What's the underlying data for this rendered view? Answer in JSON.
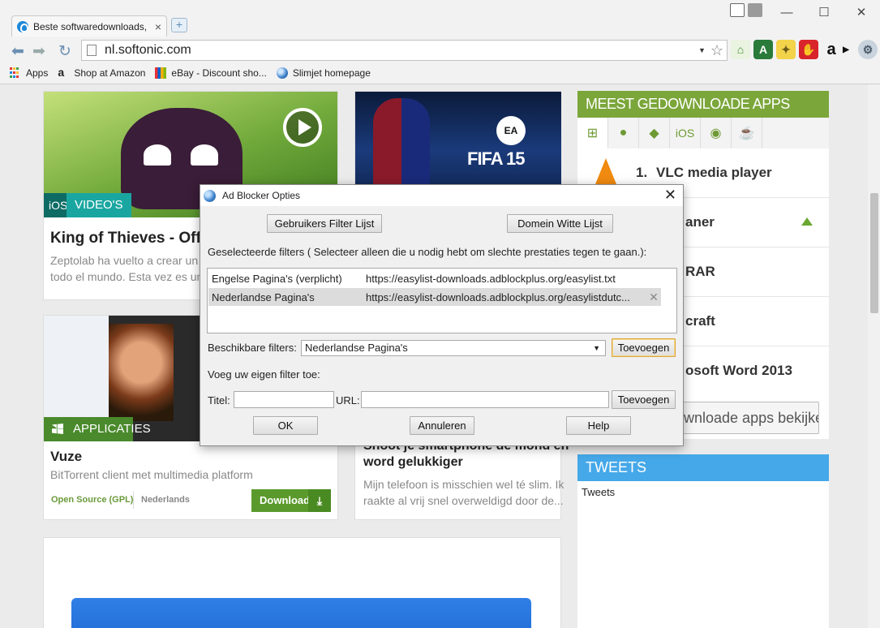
{
  "browser": {
    "tab_title": "Beste softwaredownloads,",
    "tab_close": "×",
    "new_tab": "+",
    "window_controls": [
      "—",
      "☐",
      "✕"
    ],
    "url": "nl.softonic.com",
    "bookmarks": [
      {
        "label": "Apps",
        "icon": "apps-grid-icon"
      },
      {
        "label": "Shop at Amazon",
        "icon": "amazon-icon"
      },
      {
        "label": "eBay - Discount sho...",
        "icon": "ebay-icon"
      },
      {
        "label": "Slimjet homepage",
        "icon": "globe-icon"
      }
    ]
  },
  "page": {
    "card1": {
      "badge_platform": "iOS",
      "badge_type": "VIDEO'S",
      "title": "King of Thieves - Officia",
      "desc": "Zeptolab ha vuelto a crear un perso\ntodo el mundo. Esta vez es un ladró"
    },
    "card2": {
      "game_logo": "FIFA 15",
      "brand": "EA"
    },
    "card3": {
      "badge_type": "APPLICATIES",
      "title": "Vuze",
      "desc": "BitTorrent client met multimedia platform",
      "license": "Open Source (GPL)",
      "language": "Nederlands",
      "download_label": "Download"
    },
    "card4": {
      "title_line1": "Shoot je smartphone de mond en",
      "title_line2": "word gelukkiger",
      "desc": "Mijn telefoon is misschien wel té slim. Ik\nraakte al vrij snel overweldigd door de..."
    },
    "sidebar": {
      "heading": "MEEST GEDOWNLOADE APPS",
      "tabs": [
        "windows-icon",
        "apple-icon",
        "android-icon",
        "iOS",
        "web-icon",
        "java-icon"
      ],
      "tab_ios_label": "iOS",
      "items": [
        {
          "num": "1.",
          "name": "VLC media player"
        },
        {
          "name": "aner"
        },
        {
          "name": "RAR"
        },
        {
          "name": "craft"
        },
        {
          "name": "osoft Word 2013"
        }
      ],
      "all_apps": "wnloade apps bekijken",
      "tweets_heading": "TWEETS",
      "tweets_body": "Tweets"
    }
  },
  "dialog": {
    "title": "Ad Blocker Opties",
    "close": "✕",
    "btn_user_filter": "Gebruikers Filter Lijst",
    "btn_domain_whitelist": "Domein Witte Lijst",
    "selected_filters_label": "Geselecteerde filters ( Selecteer alleen die u nodig hebt om slechte prestaties tegen te gaan.):",
    "filters": [
      {
        "name": "Engelse Pagina's (verplicht)",
        "url": "https://easylist-downloads.adblockplus.org/easylist.txt",
        "selected": false
      },
      {
        "name": "Nederlandse Pagina's",
        "url": "https://easylist-downloads.adblockplus.org/easylistdutc...",
        "selected": true
      }
    ],
    "available_label": "Beschikbare filters:",
    "available_selected": "Nederlandse Pagina's",
    "add_button": "Toevoegen",
    "own_filter_label": "Voeg uw eigen filter toe:",
    "title_label": "Titel:",
    "url_label": "URL:",
    "title_value": "",
    "url_value": "",
    "add_button2": "Toevoegen",
    "ok": "OK",
    "cancel": "Annuleren",
    "help": "Help"
  }
}
